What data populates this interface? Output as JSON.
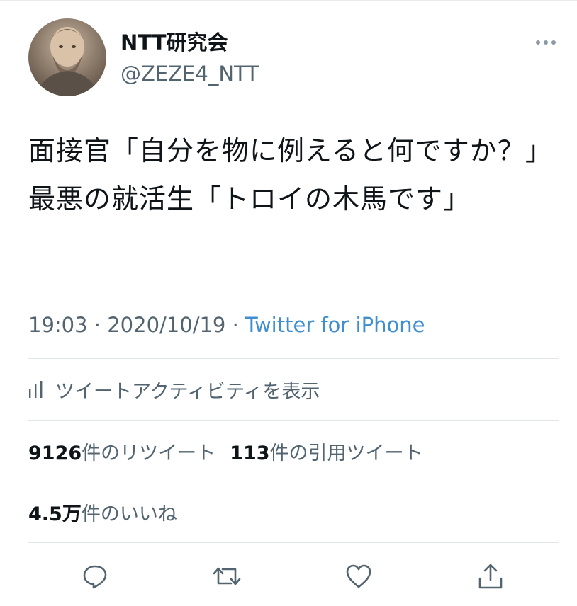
{
  "author": {
    "display_name": "NTT研究会",
    "handle": "@ZEZE4_NTT",
    "avatar_icon": "user-avatar"
  },
  "tweet": {
    "lines": [
      "面接官「自分を物に例えると何ですか？」",
      "最悪の就活生「トロイの木馬です」"
    ]
  },
  "meta": {
    "time": "19:03",
    "separator": "·",
    "date": "2020/10/19",
    "source": "Twitter for iPhone"
  },
  "activity": {
    "icon": "bar-chart-icon",
    "label": "ツイートアクティビティを表示"
  },
  "stats": {
    "retweets_count": "9126",
    "retweets_label": "件のリツイート",
    "quotes_count": "113",
    "quotes_label": "件の引用ツイート",
    "likes_count": "4.5万",
    "likes_label": "件のいいね"
  },
  "actions": [
    "reply-icon",
    "retweet-icon",
    "like-icon",
    "share-icon"
  ],
  "colors": {
    "text": "#0f1419",
    "secondary": "#536471",
    "link": "#3f8ed0",
    "divider": "#e1e6ea"
  }
}
